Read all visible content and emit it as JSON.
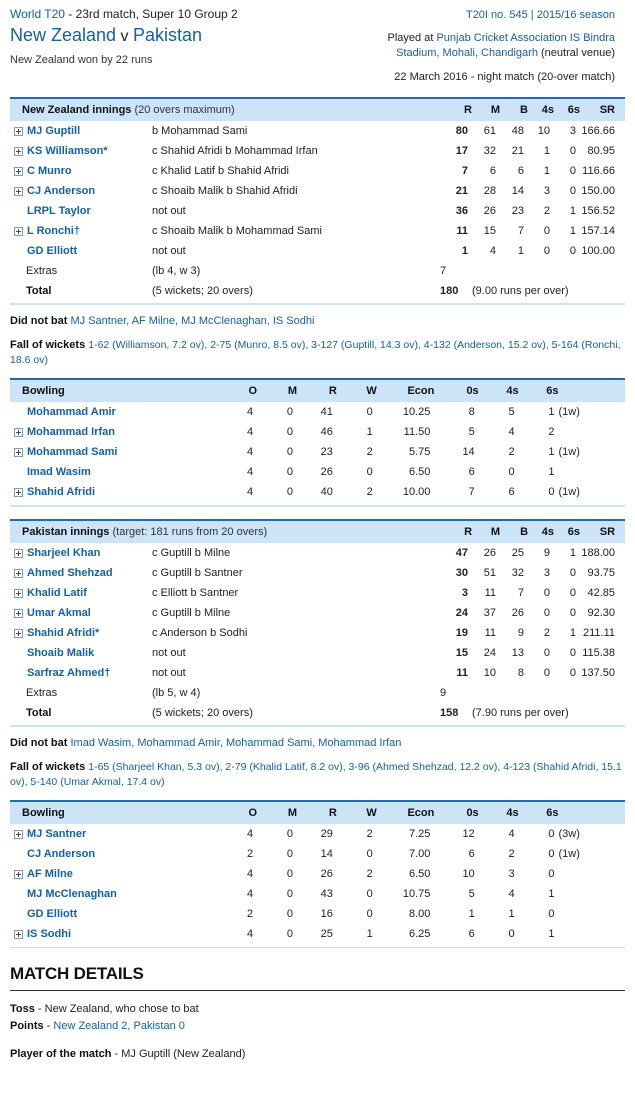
{
  "header": {
    "series": "World T20",
    "series_suffix": " - 23rd match, Super 10 Group 2",
    "teams_home": "New Zealand",
    "teams_vs": " v ",
    "teams_away": "Pakistan",
    "result": "New Zealand won by 22 runs",
    "match_no": "T20I no. 545 | 2015/16 season",
    "played_at_label": "Played at ",
    "venue": "Punjab Cricket Association IS Bindra Stadium, Mohali, Chandigarh",
    "venue_note": "(neutral venue)",
    "date_line": "22 March 2016 - night match (20-over match)"
  },
  "innings": [
    {
      "title": "New Zealand innings",
      "subtitle": "(20 overs maximum)",
      "columns": [
        "R",
        "M",
        "B",
        "4s",
        "6s",
        "SR"
      ],
      "batsmen": [
        {
          "expand": true,
          "name": "MJ Guptill",
          "dismissal": "b Mohammad Sami",
          "r": "80",
          "m": "61",
          "b": "48",
          "fours": "10",
          "sixes": "3",
          "sr": "166.66"
        },
        {
          "expand": true,
          "name": "KS Williamson*",
          "dismissal": "c Shahid Afridi b Mohammad Irfan",
          "r": "17",
          "m": "32",
          "b": "21",
          "fours": "1",
          "sixes": "0",
          "sr": "80.95"
        },
        {
          "expand": true,
          "name": "C Munro",
          "dismissal": "c Khalid Latif b Shahid Afridi",
          "r": "7",
          "m": "6",
          "b": "6",
          "fours": "1",
          "sixes": "0",
          "sr": "116.66"
        },
        {
          "expand": true,
          "name": "CJ Anderson",
          "dismissal": "c Shoaib Malik b Shahid Afridi",
          "r": "21",
          "m": "28",
          "b": "14",
          "fours": "3",
          "sixes": "0",
          "sr": "150.00"
        },
        {
          "expand": false,
          "name": "LRPL Taylor",
          "dismissal": "not out",
          "r": "36",
          "m": "26",
          "b": "23",
          "fours": "2",
          "sixes": "1",
          "sr": "156.52"
        },
        {
          "expand": true,
          "name": "L Ronchi†",
          "dismissal": "c Shoaib Malik b Mohammad Sami",
          "r": "11",
          "m": "15",
          "b": "7",
          "fours": "0",
          "sixes": "1",
          "sr": "157.14"
        },
        {
          "expand": false,
          "name": "GD Elliott",
          "dismissal": "not out",
          "r": "1",
          "m": "4",
          "b": "1",
          "fours": "0",
          "sixes": "0",
          "sr": "100.00"
        }
      ],
      "extras_label": "Extras",
      "extras_detail": "(lb 4, w 3)",
      "extras_runs": "7",
      "total_label": "Total",
      "total_detail": "(5 wickets; 20 overs)",
      "total_runs": "180",
      "total_rpo": "(9.00 runs per over)",
      "dnb_label": "Did not bat ",
      "dnb_players": "MJ Santner, AF Milne, MJ McClenaghan, IS Sodhi",
      "fow_label": "Fall of wickets ",
      "fow_text": "1-62 (Williamson, 7.2 ov), 2-75 (Munro, 8.5 ov), 3-127 (Guptill, 14.3 ov), 4-132 (Anderson, 15.2 ov), 5-164 (Ronchi, 18.6 ov)",
      "bowling": {
        "title": "Bowling",
        "columns": [
          "O",
          "M",
          "R",
          "W",
          "Econ",
          "0s",
          "4s",
          "6s"
        ],
        "rows": [
          {
            "expand": false,
            "name": "Mohammad Amir",
            "o": "4",
            "m": "0",
            "r": "41",
            "w": "0",
            "econ": "10.25",
            "zeros": "8",
            "fours": "5",
            "sixes": "1",
            "wides": "(1w)"
          },
          {
            "expand": true,
            "name": "Mohammad Irfan",
            "o": "4",
            "m": "0",
            "r": "46",
            "w": "1",
            "econ": "11.50",
            "zeros": "5",
            "fours": "4",
            "sixes": "2",
            "wides": ""
          },
          {
            "expand": true,
            "name": "Mohammad Sami",
            "o": "4",
            "m": "0",
            "r": "23",
            "w": "2",
            "econ": "5.75",
            "zeros": "14",
            "fours": "2",
            "sixes": "1",
            "wides": "(1w)"
          },
          {
            "expand": false,
            "name": "Imad Wasim",
            "o": "4",
            "m": "0",
            "r": "26",
            "w": "0",
            "econ": "6.50",
            "zeros": "6",
            "fours": "0",
            "sixes": "1",
            "wides": ""
          },
          {
            "expand": true,
            "name": "Shahid Afridi",
            "o": "4",
            "m": "0",
            "r": "40",
            "w": "2",
            "econ": "10.00",
            "zeros": "7",
            "fours": "6",
            "sixes": "0",
            "wides": "(1w)"
          }
        ]
      }
    },
    {
      "title": "Pakistan innings",
      "subtitle": "(target: 181 runs from 20 overs)",
      "columns": [
        "R",
        "M",
        "B",
        "4s",
        "6s",
        "SR"
      ],
      "batsmen": [
        {
          "expand": true,
          "name": "Sharjeel Khan",
          "dismissal": "c Guptill b Milne",
          "r": "47",
          "m": "26",
          "b": "25",
          "fours": "9",
          "sixes": "1",
          "sr": "188.00"
        },
        {
          "expand": true,
          "name": "Ahmed Shehzad",
          "dismissal": "c Guptill b Santner",
          "r": "30",
          "m": "51",
          "b": "32",
          "fours": "3",
          "sixes": "0",
          "sr": "93.75"
        },
        {
          "expand": true,
          "name": "Khalid Latif",
          "dismissal": "c Elliott b Santner",
          "r": "3",
          "m": "11",
          "b": "7",
          "fours": "0",
          "sixes": "0",
          "sr": "42.85"
        },
        {
          "expand": true,
          "name": "Umar Akmal",
          "dismissal": "c Guptill b Milne",
          "r": "24",
          "m": "37",
          "b": "26",
          "fours": "0",
          "sixes": "0",
          "sr": "92.30"
        },
        {
          "expand": true,
          "name": "Shahid Afridi*",
          "dismissal": "c Anderson b Sodhi",
          "r": "19",
          "m": "11",
          "b": "9",
          "fours": "2",
          "sixes": "1",
          "sr": "211.11"
        },
        {
          "expand": false,
          "name": "Shoaib Malik",
          "dismissal": "not out",
          "r": "15",
          "m": "24",
          "b": "13",
          "fours": "0",
          "sixes": "0",
          "sr": "115.38"
        },
        {
          "expand": false,
          "name": "Sarfraz Ahmed†",
          "dismissal": "not out",
          "r": "11",
          "m": "10",
          "b": "8",
          "fours": "0",
          "sixes": "0",
          "sr": "137.50"
        }
      ],
      "extras_label": "Extras",
      "extras_detail": "(lb 5, w 4)",
      "extras_runs": "9",
      "total_label": "Total",
      "total_detail": "(5 wickets; 20 overs)",
      "total_runs": "158",
      "total_rpo": "(7.90 runs per over)",
      "dnb_label": "Did not bat ",
      "dnb_players": "Imad Wasim, Mohammad Amir, Mohammad Sami, Mohammad Irfan",
      "fow_label": "Fall of wickets ",
      "fow_text": "1-65 (Sharjeel Khan, 5.3 ov), 2-79 (Khalid Latif, 8.2 ov), 3-96 (Ahmed Shehzad, 12.2 ov), 4-123 (Shahid Afridi, 15.1 ov), 5-140 (Umar Akmal, 17.4 ov)",
      "bowling": {
        "title": "Bowling",
        "columns": [
          "O",
          "M",
          "R",
          "W",
          "Econ",
          "0s",
          "4s",
          "6s"
        ],
        "rows": [
          {
            "expand": true,
            "name": "MJ Santner",
            "o": "4",
            "m": "0",
            "r": "29",
            "w": "2",
            "econ": "7.25",
            "zeros": "12",
            "fours": "4",
            "sixes": "0",
            "wides": "(3w)"
          },
          {
            "expand": false,
            "name": "CJ Anderson",
            "o": "2",
            "m": "0",
            "r": "14",
            "w": "0",
            "econ": "7.00",
            "zeros": "6",
            "fours": "2",
            "sixes": "0",
            "wides": "(1w)"
          },
          {
            "expand": true,
            "name": "AF Milne",
            "o": "4",
            "m": "0",
            "r": "26",
            "w": "2",
            "econ": "6.50",
            "zeros": "10",
            "fours": "3",
            "sixes": "0",
            "wides": ""
          },
          {
            "expand": false,
            "name": "MJ McClenaghan",
            "o": "4",
            "m": "0",
            "r": "43",
            "w": "0",
            "econ": "10.75",
            "zeros": "5",
            "fours": "4",
            "sixes": "1",
            "wides": ""
          },
          {
            "expand": false,
            "name": "GD Elliott",
            "o": "2",
            "m": "0",
            "r": "16",
            "w": "0",
            "econ": "8.00",
            "zeros": "1",
            "fours": "1",
            "sixes": "0",
            "wides": ""
          },
          {
            "expand": true,
            "name": "IS Sodhi",
            "o": "4",
            "m": "0",
            "r": "25",
            "w": "1",
            "econ": "6.25",
            "zeros": "6",
            "fours": "0",
            "sixes": "1",
            "wides": ""
          }
        ]
      }
    }
  ],
  "details": {
    "heading": "MATCH DETAILS",
    "toss_label": "Toss",
    "toss_value": " - New Zealand, who chose to bat",
    "points_label": "Points",
    "points_dash": " - ",
    "points_value": "New Zealand 2, Pakistan 0",
    "potm_label": "Player of the match",
    "potm_value": " - MJ Guptill (New Zealand)"
  }
}
